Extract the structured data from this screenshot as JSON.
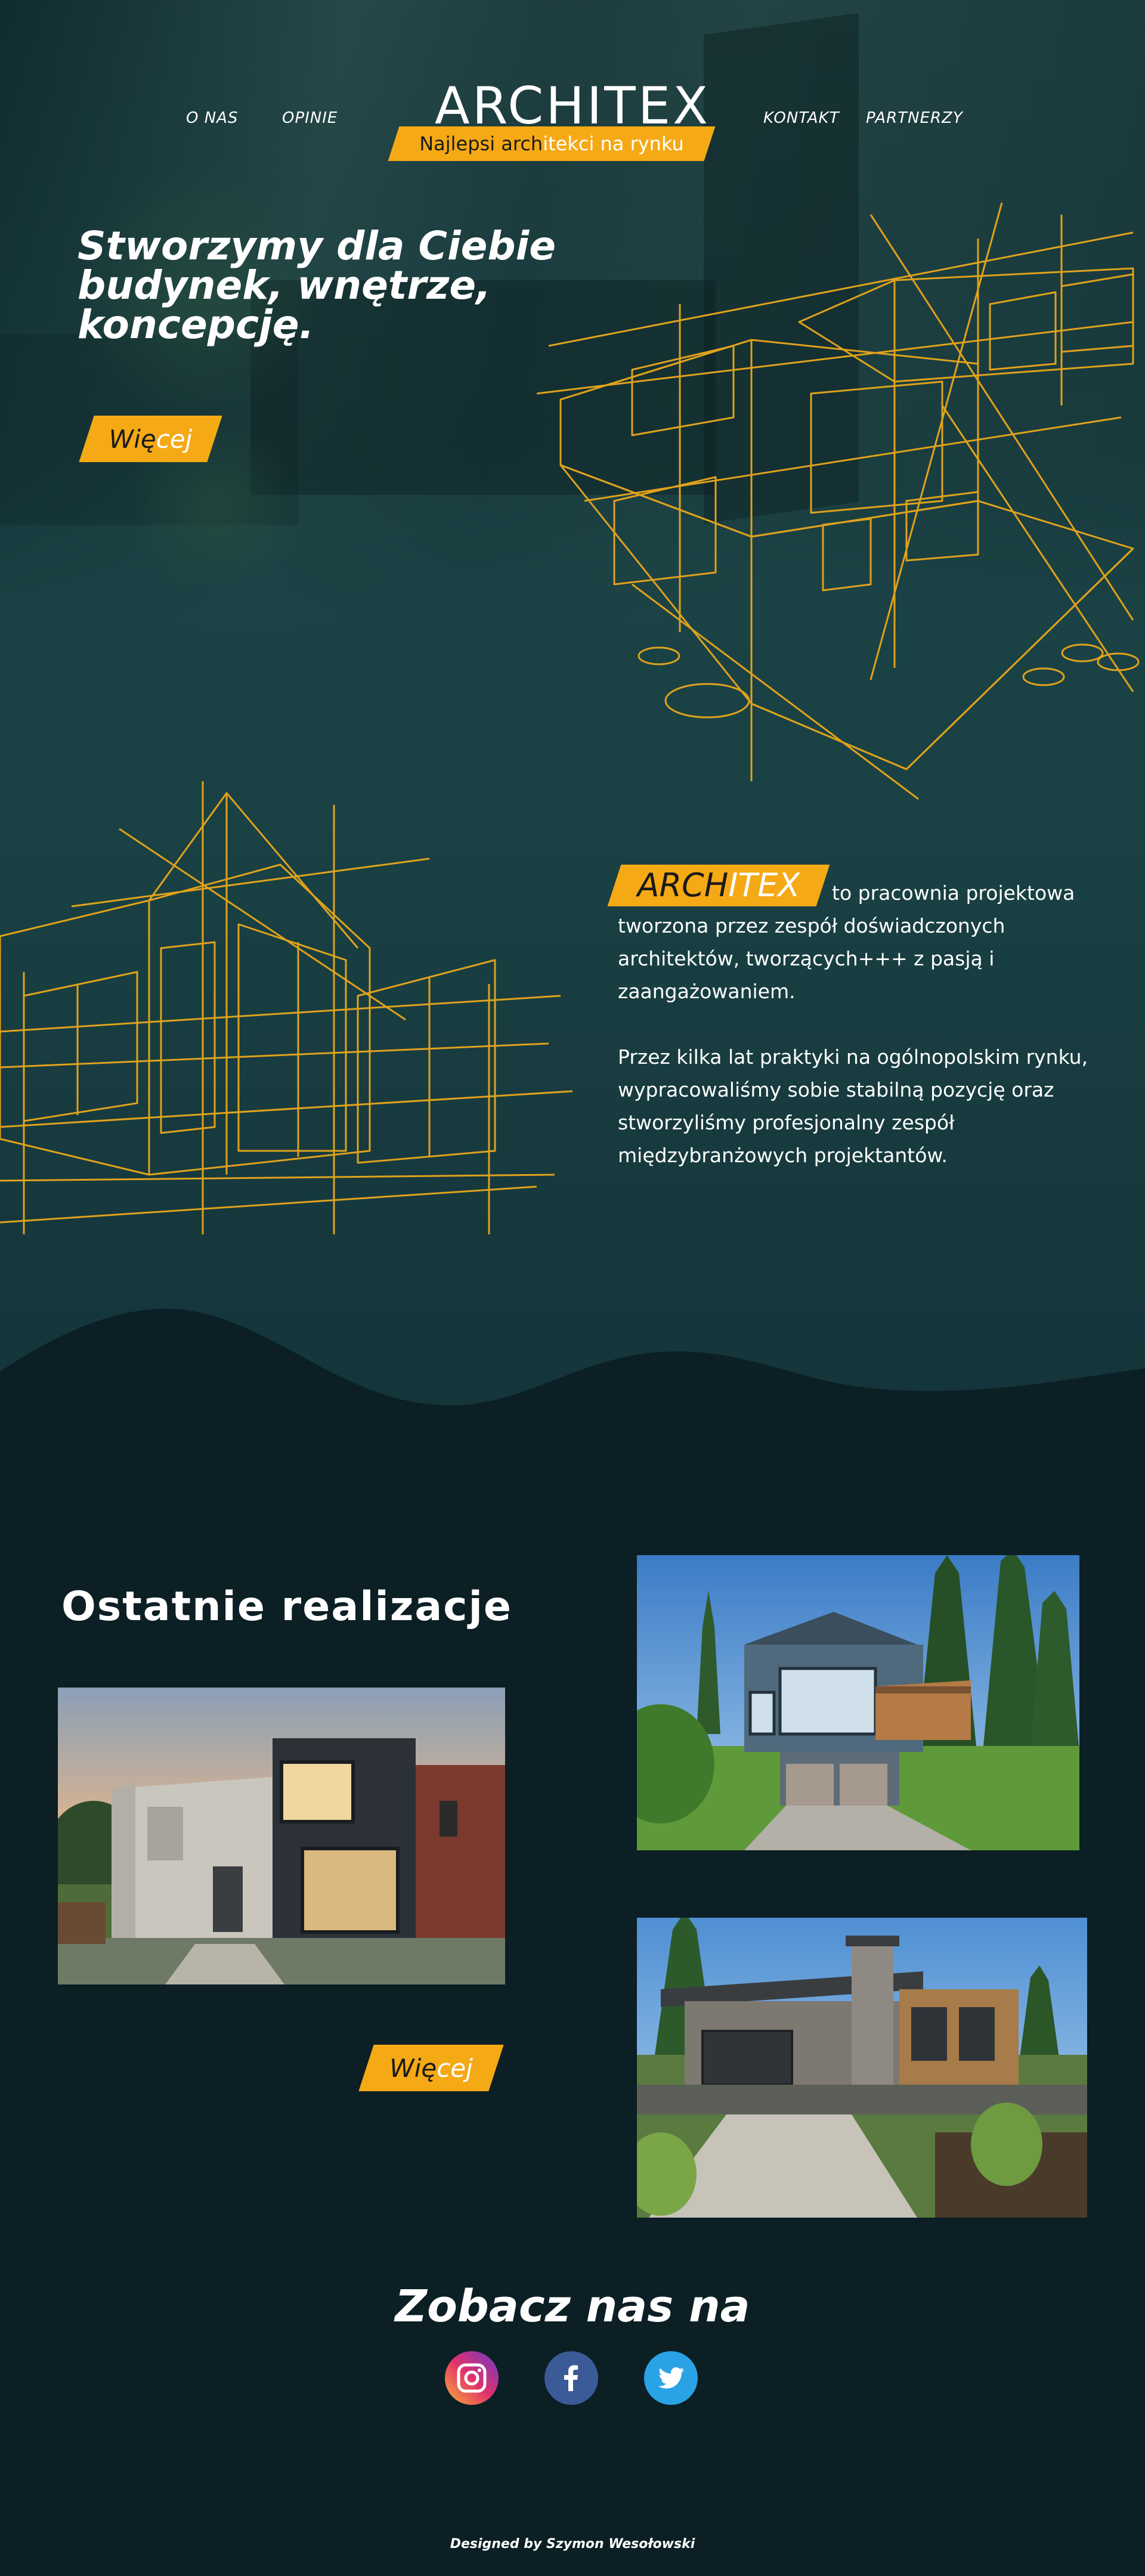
{
  "nav": {
    "about": "O NAS",
    "reviews": "OPINIE",
    "contact": "KONTAKT",
    "partners": "PARTNERZY"
  },
  "logo": {
    "title": "ARCHITEX",
    "tagline_start": "Najlepsi arch",
    "tagline_highlight": "itekci na rynku"
  },
  "hero": {
    "heading": "Stworzymy dla Ciebie\nbudynek, wnętrze,\nkoncepcję.",
    "more_start": "Wię",
    "more_highlight": "cej"
  },
  "about": {
    "brand_start": "ARCH",
    "brand_highlight": "ITEX",
    "line1": "to pracownia projektowa",
    "line2": "tworzona przez zespół doświadczonych",
    "line3": "architektów, tworzących+++ z pasją i",
    "line4": "zaangażowaniem.",
    "para2_line1": "Przez kilka lat praktyki na ogólnopolskim rynku,",
    "para2_line2": "wypracowaliśmy sobie stabilną pozycję oraz",
    "para2_line3": "stworzyliśmy profesjonalny zespół",
    "para2_line4": "międzybranżowych projektantów."
  },
  "realizations": {
    "title": "Ostatnie realizacje",
    "more_start": "Wię",
    "more_highlight": "cej"
  },
  "social": {
    "heading": "Zobacz nas na",
    "instagram": "instagram-icon",
    "facebook": "facebook-icon",
    "twitter": "twitter-icon"
  },
  "footer": {
    "credit": "Designed by Szymon Wesołowski"
  },
  "colors": {
    "accent": "#f5a915",
    "hero_bg": "#1b4346",
    "dark_bg": "#0b1f24"
  }
}
